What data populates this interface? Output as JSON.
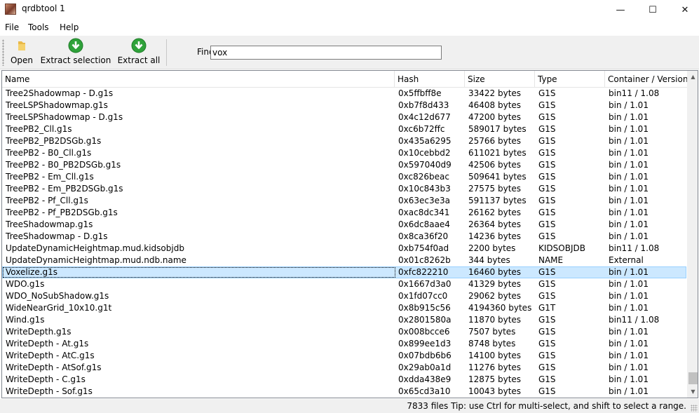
{
  "window": {
    "title": "qrdbtool",
    "title_suffix": "1",
    "minimize": "—",
    "maximize": "☐",
    "close": "✕"
  },
  "menu": [
    "File",
    "Tools",
    "Help"
  ],
  "toolbar": {
    "open_label": "Open",
    "extract_selection_label": "Extract selection",
    "extract_all_label": "Extract all",
    "find_label": "Find:",
    "find_value": "vox"
  },
  "columns": [
    "Name",
    "Hash",
    "Size",
    "Type",
    "Container / Version"
  ],
  "rows": [
    [
      "Tree2Shadowmap - D.g1s",
      "0x5ffbff8e",
      "33422 bytes",
      "G1S",
      "bin11 / 1.08"
    ],
    [
      "TreeLSPShadowmap.g1s",
      "0xb7f8d433",
      "46408 bytes",
      "G1S",
      "bin / 1.01"
    ],
    [
      "TreeLSPShadowmap - D.g1s",
      "0x4c12d677",
      "47200 bytes",
      "G1S",
      "bin / 1.01"
    ],
    [
      "TreePB2_Cll.g1s",
      "0xc6b72ffc",
      "589017 bytes",
      "G1S",
      "bin / 1.01"
    ],
    [
      "TreePB2_PB2DSGb.g1s",
      "0x435a6295",
      "25766 bytes",
      "G1S",
      "bin / 1.01"
    ],
    [
      "TreePB2 - B0_Cll.g1s",
      "0x10cebbd2",
      "611021 bytes",
      "G1S",
      "bin / 1.01"
    ],
    [
      "TreePB2 - B0_PB2DSGb.g1s",
      "0x597040d9",
      "42506 bytes",
      "G1S",
      "bin / 1.01"
    ],
    [
      "TreePB2 - Em_Cll.g1s",
      "0xc826beac",
      "509641 bytes",
      "G1S",
      "bin / 1.01"
    ],
    [
      "TreePB2 - Em_PB2DSGb.g1s",
      "0x10c843b3",
      "27575 bytes",
      "G1S",
      "bin / 1.01"
    ],
    [
      "TreePB2 - Pf_Cll.g1s",
      "0x63ec3e3a",
      "591137 bytes",
      "G1S",
      "bin / 1.01"
    ],
    [
      "TreePB2 - Pf_PB2DSGb.g1s",
      "0xac8dc341",
      "26162 bytes",
      "G1S",
      "bin / 1.01"
    ],
    [
      "TreeShadowmap.g1s",
      "0x6dc8aae4",
      "26364 bytes",
      "G1S",
      "bin / 1.01"
    ],
    [
      "TreeShadowmap - D.g1s",
      "0x8ca36f20",
      "14236 bytes",
      "G1S",
      "bin / 1.01"
    ],
    [
      "UpdateDynamicHeightmap.mud.kidsobjdb",
      "0xb754f0ad",
      "2200 bytes",
      "KIDSOBJDB",
      "bin11 / 1.08"
    ],
    [
      "UpdateDynamicHeightmap.mud.ndb.name",
      "0x01c8262b",
      "344 bytes",
      "NAME",
      "External"
    ],
    [
      "Voxelize.g1s",
      "0xfc822210",
      "16460 bytes",
      "G1S",
      "bin / 1.01"
    ],
    [
      "WDO.g1s",
      "0x1667d3a0",
      "41329 bytes",
      "G1S",
      "bin / 1.01"
    ],
    [
      "WDO_NoSubShadow.g1s",
      "0x1fd07cc0",
      "29062 bytes",
      "G1S",
      "bin / 1.01"
    ],
    [
      "WideNearGrid_10x10.g1t",
      "0x8b915c56",
      "4194360 bytes",
      "G1T",
      "bin / 1.01"
    ],
    [
      "Wind.g1s",
      "0x2801580a",
      "11870 bytes",
      "G1S",
      "bin11 / 1.08"
    ],
    [
      "WriteDepth.g1s",
      "0x008bcce6",
      "7507 bytes",
      "G1S",
      "bin / 1.01"
    ],
    [
      "WriteDepth - At.g1s",
      "0x899ee1d3",
      "8748 bytes",
      "G1S",
      "bin / 1.01"
    ],
    [
      "WriteDepth - AtC.g1s",
      "0x07bdb6b6",
      "14100 bytes",
      "G1S",
      "bin / 1.01"
    ],
    [
      "WriteDepth - AtSof.g1s",
      "0x29ab0a1d",
      "11276 bytes",
      "G1S",
      "bin / 1.01"
    ],
    [
      "WriteDepth - C.g1s",
      "0xdda438e9",
      "12875 bytes",
      "G1S",
      "bin / 1.01"
    ],
    [
      "WriteDepth - Sof.g1s",
      "0x65cd3a10",
      "10043 bytes",
      "G1S",
      "bin / 1.01"
    ]
  ],
  "selected_row": "Voxelize.g1s",
  "status": {
    "text": "7833 files  Tip: use Ctrl for multi-select, and shift to select a range."
  },
  "colors": {
    "selection": "#cce8ff",
    "selection_border": "#99d1ff",
    "toolbar": "#f0f0f0",
    "extract_icon": "#2fa23a"
  },
  "icons": {
    "app": "app-icon",
    "open": "folder-icon",
    "extract_selection": "download-arrow-icon",
    "extract_all": "download-arrow-icon",
    "sort": "sort-ascending-icon"
  }
}
